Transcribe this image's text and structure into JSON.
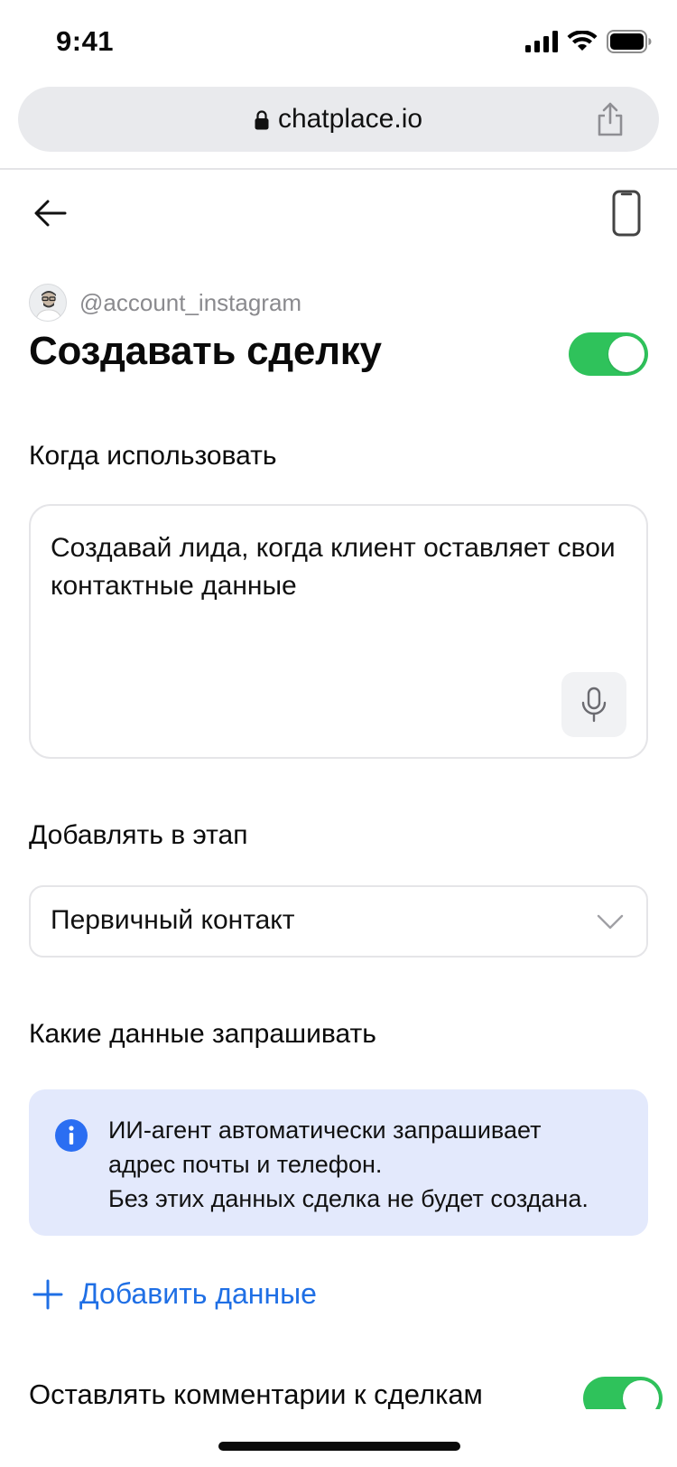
{
  "status_bar": {
    "time": "9:41"
  },
  "browser": {
    "url": "chatplace.io"
  },
  "account": {
    "handle": "@account_instagram"
  },
  "header": {
    "title": "Создавать сделку",
    "enabled": true
  },
  "when_to_use": {
    "label": "Когда использовать",
    "value": "Создавай лида, когда клиент оставляет свои контактные данные"
  },
  "stage": {
    "label": "Добавлять в этап",
    "selected": "Первичный контакт"
  },
  "requested_data": {
    "label": "Какие данные запрашивать",
    "info_lines": [
      "ИИ-агент автоматически запрашивает",
      "адрес почты и телефон.",
      "Без этих данных сделка не будет создана."
    ],
    "add_label": "Добавить данные"
  },
  "comments": {
    "label": "Оставлять комментарии к сделкам",
    "enabled": true
  },
  "colors": {
    "toggle_on": "#2fc25b",
    "accent_blue": "#1f6fe5",
    "info_background": "#e3e9fc"
  }
}
